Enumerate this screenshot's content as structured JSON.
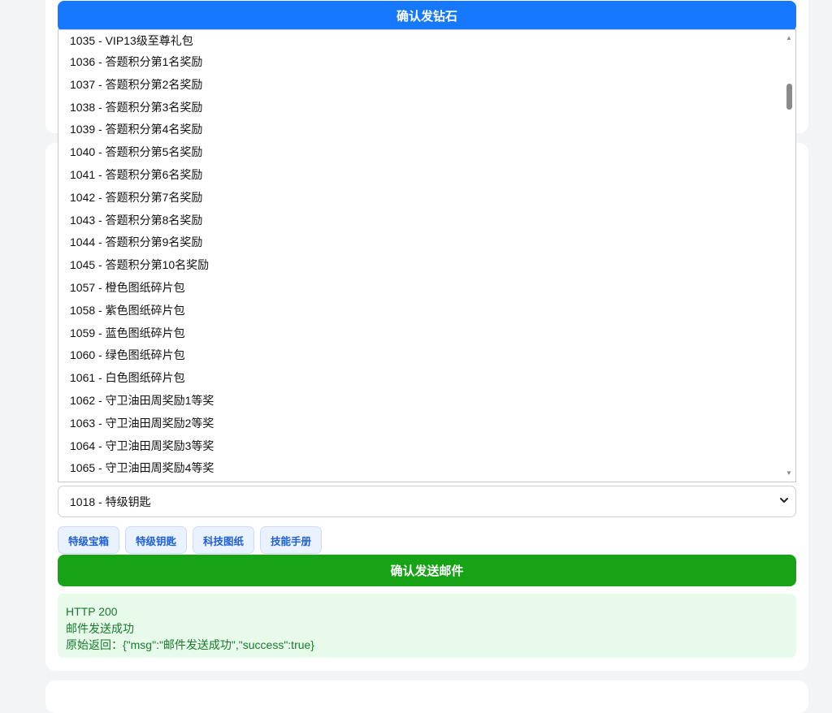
{
  "confirm_diamond_button": "确认发钻石",
  "item_list": [
    "1035 - VIP13级至尊礼包",
    "1036 - 答题积分第1名奖励",
    "1037 - 答题积分第2名奖励",
    "1038 - 答题积分第3名奖励",
    "1039 - 答题积分第4名奖励",
    "1040 - 答题积分第5名奖励",
    "1041 - 答题积分第6名奖励",
    "1042 - 答题积分第7名奖励",
    "1043 - 答题积分第8名奖励",
    "1044 - 答题积分第9名奖励",
    "1045 - 答题积分第10名奖励",
    "1057 - 橙色图纸碎片包",
    "1058 - 紫色图纸碎片包",
    "1059 - 蓝色图纸碎片包",
    "1060 - 绿色图纸碎片包",
    "1061 - 白色图纸碎片包",
    "1062 - 守卫油田周奖励1等奖",
    "1063 - 守卫油田周奖励2等奖",
    "1064 - 守卫油田周奖励3等奖",
    "1065 - 守卫油田周奖励4等奖"
  ],
  "item_select": {
    "selected": "1018 - 特级钥匙"
  },
  "quick_buttons": [
    "特级宝箱",
    "特级钥匙",
    "科技图纸",
    "技能手册"
  ],
  "send_mail_button": "确认发送邮件",
  "result": {
    "status": "HTTP 200",
    "message": "邮件发送成功",
    "raw": "原始返回：{\"msg\":\"邮件发送成功\",\"success\":true}"
  },
  "colors": {
    "primary_blue": "#1677ff",
    "success_green": "#16a316",
    "result_bg": "#e8fbeb",
    "result_text": "#167a2c"
  }
}
